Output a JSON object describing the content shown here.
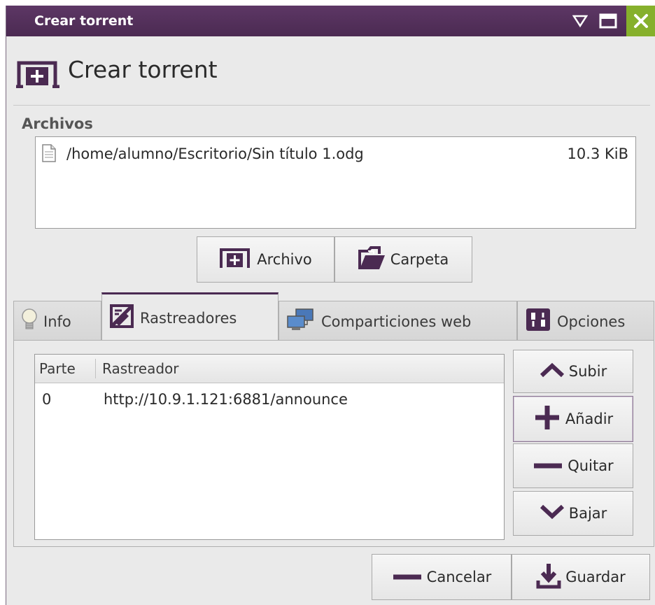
{
  "window": {
    "title": "Crear torrent",
    "controls": [
      "menu-icon",
      "maximize-icon",
      "close-icon"
    ]
  },
  "header": {
    "title": "Crear torrent",
    "icon": "torrent-add-icon"
  },
  "files": {
    "label": "Archivos",
    "items": [
      {
        "path": "/home/alumno/Escritorio/Sin título 1.odg",
        "size": "10.3 KiB",
        "icon": "file-icon"
      }
    ],
    "add_file_label": "Archivo",
    "add_folder_label": "Carpeta"
  },
  "tabs": [
    {
      "label": "Info",
      "icon": "lightbulb-icon",
      "active": false
    },
    {
      "label": "Rastreadores",
      "icon": "trackers-icon",
      "active": true
    },
    {
      "label": "Comparticiones web",
      "icon": "network-icon",
      "active": false
    },
    {
      "label": "Opciones",
      "icon": "options-icon",
      "active": false
    }
  ],
  "trackers": {
    "columns": [
      "Parte",
      "Rastreador"
    ],
    "rows": [
      {
        "tier": "0",
        "url": "http://10.9.1.121:6881/announce"
      }
    ],
    "buttons": {
      "up": "Subir",
      "add": "Añadir",
      "remove": "Quitar",
      "down": "Bajar"
    }
  },
  "footer": {
    "cancel": "Cancelar",
    "save": "Guardar"
  },
  "colors": {
    "accent": "#4b2a52",
    "close": "#86b02c",
    "background": "#eaeaea"
  }
}
